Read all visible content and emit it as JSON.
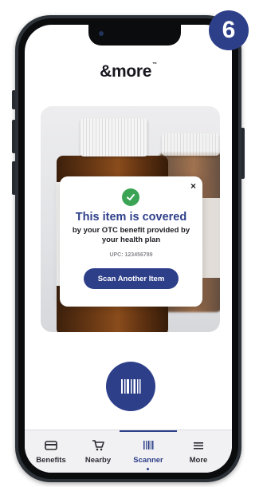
{
  "app": {
    "logo_text": "&more",
    "logo_mark": "™"
  },
  "step_badge": "6",
  "popup": {
    "title": "This item is covered",
    "subtitle": "by your OTC benefit provided by your health plan",
    "upc": "UPC: 123456789",
    "button_label": "Scan Another Item",
    "close_symbol": "×",
    "status_color": "#3aa454"
  },
  "tabs": [
    {
      "label": "Benefits",
      "icon": "card-icon"
    },
    {
      "label": "Nearby",
      "icon": "cart-icon"
    },
    {
      "label": "Scanner",
      "icon": "barcode-icon",
      "active": true
    },
    {
      "label": "More",
      "icon": "menu-icon"
    }
  ],
  "colors": {
    "brand": "#2e3f8a",
    "success": "#3aa454"
  }
}
